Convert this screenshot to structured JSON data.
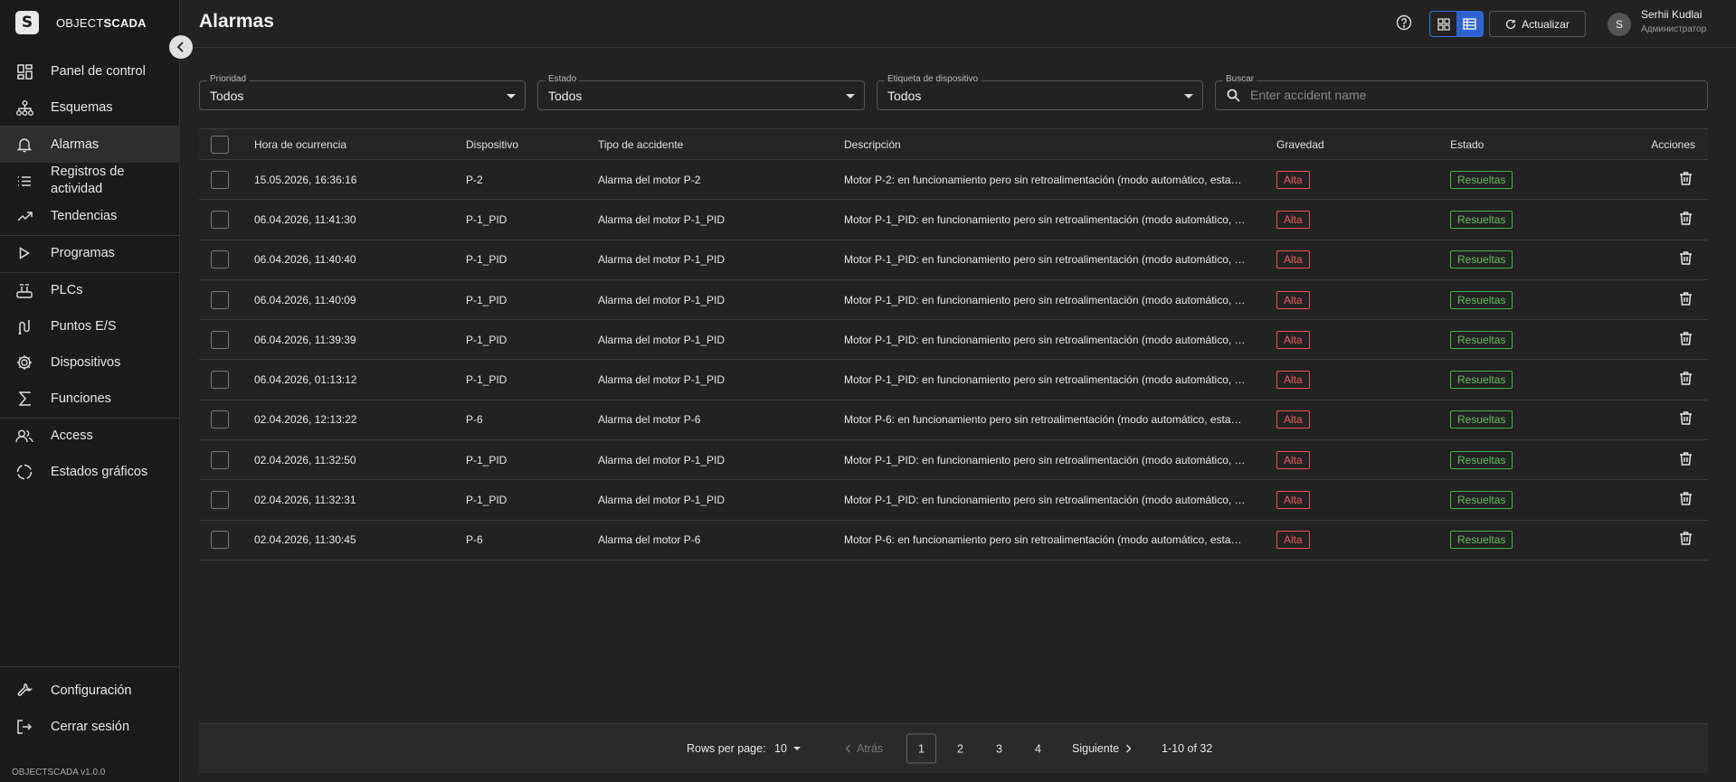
{
  "brand": {
    "logo_letter": "S",
    "name_light": "OBJECT",
    "name_bold": "SCADA",
    "version": "OBJECTSCADA v1.0.0"
  },
  "sidebar": {
    "items": [
      {
        "label": "Panel de control",
        "icon": "dashboard-icon"
      },
      {
        "label": "Esquemas",
        "icon": "schema-icon"
      },
      {
        "label": "Alarmas",
        "icon": "bell-icon"
      },
      {
        "label": "Registros de actividad",
        "icon": "list-icon"
      },
      {
        "label": "Tendencias",
        "icon": "trend-icon"
      },
      {
        "label": "Programas",
        "icon": "play-icon"
      },
      {
        "label": "PLCs",
        "icon": "router-icon"
      },
      {
        "label": "Puntos E/S",
        "icon": "io-points-icon"
      },
      {
        "label": "Dispositivos",
        "icon": "device-icon"
      },
      {
        "label": "Funciones",
        "icon": "sigma-icon"
      },
      {
        "label": "Access",
        "icon": "users-icon"
      },
      {
        "label": "Estados gráficos",
        "icon": "graphic-states-icon"
      }
    ],
    "bottom": [
      {
        "label": "Configuración",
        "icon": "wrench-icon"
      },
      {
        "label": "Cerrar sesión",
        "icon": "logout-icon"
      }
    ]
  },
  "header": {
    "title": "Alarmas",
    "refresh_label": "Actualizar",
    "user_initial": "S",
    "user_name": "Serhii Kudlai",
    "user_role": "Администратор"
  },
  "filters": {
    "priority": {
      "label": "Prioridad",
      "value": "Todos"
    },
    "state": {
      "label": "Estado",
      "value": "Todos"
    },
    "device_tag": {
      "label": "Etiqueta de dispositivo",
      "value": "Todos"
    },
    "search": {
      "label": "Buscar",
      "placeholder": "Enter accident name"
    }
  },
  "table": {
    "columns": [
      "Hora de ocurrencia",
      "Dispositivo",
      "Tipo de accidente",
      "Descripción",
      "Gravedad",
      "Estado",
      "Acciones"
    ],
    "rows": [
      {
        "time": "15.05.2026, 16:36:16",
        "device": "P-2",
        "type": "Alarma del motor P-2",
        "desc": "Motor P-2: en funcionamiento pero sin retroalimentación (modo automático, esta…",
        "severity": "Alta",
        "state": "Resueltas"
      },
      {
        "time": "06.04.2026, 11:41:30",
        "device": "P-1_PID",
        "type": "Alarma del motor P-1_PID",
        "desc": "Motor P-1_PID: en funcionamiento pero sin retroalimentación (modo automático, …",
        "severity": "Alta",
        "state": "Resueltas"
      },
      {
        "time": "06.04.2026, 11:40:40",
        "device": "P-1_PID",
        "type": "Alarma del motor P-1_PID",
        "desc": "Motor P-1_PID: en funcionamiento pero sin retroalimentación (modo automático, …",
        "severity": "Alta",
        "state": "Resueltas"
      },
      {
        "time": "06.04.2026, 11:40:09",
        "device": "P-1_PID",
        "type": "Alarma del motor P-1_PID",
        "desc": "Motor P-1_PID: en funcionamiento pero sin retroalimentación (modo automático, …",
        "severity": "Alta",
        "state": "Resueltas"
      },
      {
        "time": "06.04.2026, 11:39:39",
        "device": "P-1_PID",
        "type": "Alarma del motor P-1_PID",
        "desc": "Motor P-1_PID: en funcionamiento pero sin retroalimentación (modo automático, …",
        "severity": "Alta",
        "state": "Resueltas"
      },
      {
        "time": "06.04.2026, 01:13:12",
        "device": "P-1_PID",
        "type": "Alarma del motor P-1_PID",
        "desc": "Motor P-1_PID: en funcionamiento pero sin retroalimentación (modo automático, …",
        "severity": "Alta",
        "state": "Resueltas"
      },
      {
        "time": "02.04.2026, 12:13:22",
        "device": "P-6",
        "type": "Alarma del motor P-6",
        "desc": "Motor P-6: en funcionamiento pero sin retroalimentación (modo automático, esta…",
        "severity": "Alta",
        "state": "Resueltas"
      },
      {
        "time": "02.04.2026, 11:32:50",
        "device": "P-1_PID",
        "type": "Alarma del motor P-1_PID",
        "desc": "Motor P-1_PID: en funcionamiento pero sin retroalimentación (modo automático, …",
        "severity": "Alta",
        "state": "Resueltas"
      },
      {
        "time": "02.04.2026, 11:32:31",
        "device": "P-1_PID",
        "type": "Alarma del motor P-1_PID",
        "desc": "Motor P-1_PID: en funcionamiento pero sin retroalimentación (modo automático, …",
        "severity": "Alta",
        "state": "Resueltas"
      },
      {
        "time": "02.04.2026, 11:30:45",
        "device": "P-6",
        "type": "Alarma del motor P-6",
        "desc": "Motor P-6: en funcionamiento pero sin retroalimentación (modo automático, esta…",
        "severity": "Alta",
        "state": "Resueltas"
      }
    ]
  },
  "pagination": {
    "rows_per_page_label": "Rows per page:",
    "rows_per_page": "10",
    "prev_label": "Atrás",
    "next_label": "Siguiente",
    "pages": [
      "1",
      "2",
      "3",
      "4"
    ],
    "current_page": "1",
    "range": "1-10 of 32"
  },
  "colors": {
    "accent": "#2e63d1",
    "severity_high": "#ef5b60",
    "state_resolved": "#5ec062"
  }
}
